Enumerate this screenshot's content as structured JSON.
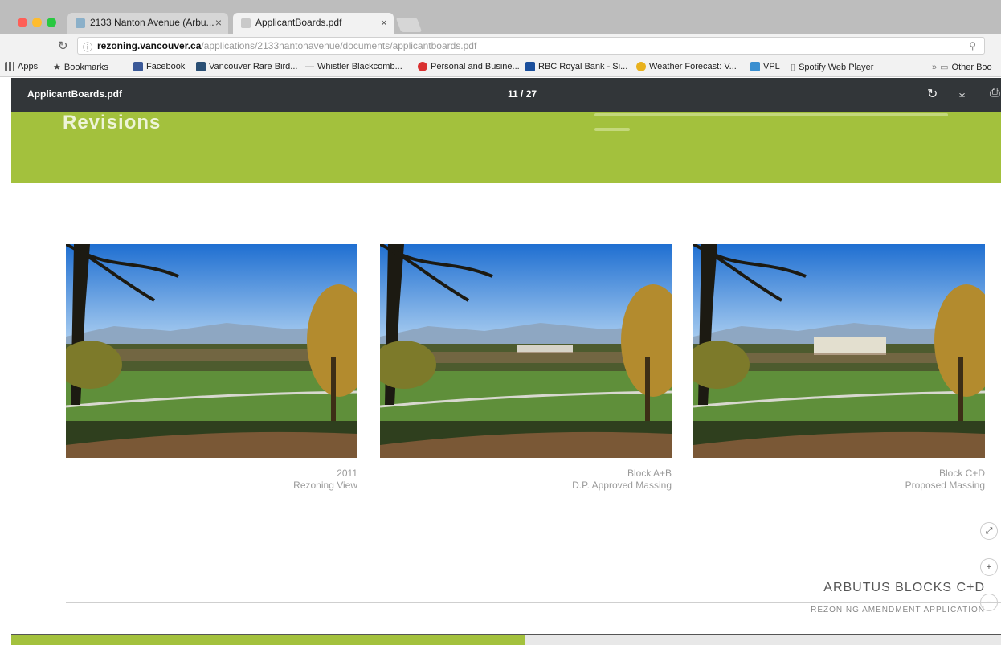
{
  "browser": {
    "tabs": [
      {
        "label": "2133 Nanton Avenue (Arbu...",
        "active": false
      },
      {
        "label": "ApplicantBoards.pdf",
        "active": true
      }
    ],
    "address": {
      "host": "rezoning.vancouver.ca",
      "path": "/applications/2133nantonavenue/documents/applicantboards.pdf"
    },
    "bookmarks": [
      {
        "label": "Apps",
        "icon": "apps-grid-icon"
      },
      {
        "label": "Bookmarks",
        "icon": "star-icon"
      },
      {
        "label": "Facebook",
        "icon": "facebook-icon"
      },
      {
        "label": "Vancouver Rare Bird...",
        "icon": "bird-icon"
      },
      {
        "label": "Whistler Blackcomb...",
        "icon": "ski-icon"
      },
      {
        "label": "Personal and Busine...",
        "icon": "bank-icon"
      },
      {
        "label": "RBC Royal Bank - Si...",
        "icon": "rbc-icon"
      },
      {
        "label": "Weather Forecast: V...",
        "icon": "weather-icon"
      },
      {
        "label": "VPL",
        "icon": "library-icon"
      },
      {
        "label": "Spotify Web Player",
        "icon": "page-icon"
      },
      {
        "label": "Other Boo",
        "icon": "folder-icon"
      }
    ]
  },
  "pdf": {
    "filename": "ApplicantBoards.pdf",
    "page_indicator": "11 / 27",
    "heading": "Revisions",
    "photos": [
      {
        "caption_line1": "2011",
        "caption_line2": "Rezoning View",
        "building": "none"
      },
      {
        "caption_line1": "Block A+B",
        "caption_line2": "D.P. Approved Massing",
        "building": "small"
      },
      {
        "caption_line1": "Block C+D",
        "caption_line2": "Proposed Massing",
        "building": "large"
      }
    ],
    "brand_title": "ARBUTUS BLOCKS C+D",
    "brand_subtitle": "REZONING AMENDMENT APPLICATION"
  },
  "colors": {
    "accent_green": "#a3c13d",
    "toolbar_dark": "#323639"
  }
}
